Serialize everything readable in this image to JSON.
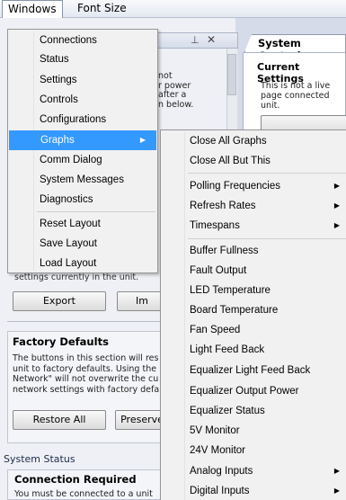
{
  "menubar": {
    "windows": "Windows",
    "font_size": "Font Size"
  },
  "background": {
    "panel_side_text": "not\nr power\nafter a\nn below.",
    "system_controls_tab": "System Controls",
    "current_settings_title": "Current Settings",
    "current_settings_note": "This is not a live page connected unit.",
    "settings_text": "settings currently in the unit.",
    "export_button": "Export",
    "import_button": "Im",
    "factory_defaults_title": "Factory Defaults",
    "factory_defaults_text": "The buttons in this section will res unit to factory defaults. Using the Network\" will not overwrite the cu network settings with factory defa",
    "restore_all_button": "Restore All",
    "preserve_button": "Preserve",
    "system_status_label": "System Status",
    "connection_required_title": "Connection Required",
    "connection_required_text": "You must be connected to a unit"
  },
  "windows_menu": {
    "items": [
      {
        "label": "Connections"
      },
      {
        "label": "Status"
      },
      {
        "label": "Settings"
      },
      {
        "label": "Controls"
      },
      {
        "label": "Configurations"
      },
      {
        "label": "Graphs"
      },
      {
        "label": "Comm Dialog"
      },
      {
        "label": "System Messages"
      },
      {
        "label": "Diagnostics"
      },
      {
        "label": "Reset Layout"
      },
      {
        "label": "Save Layout"
      },
      {
        "label": "Load Layout"
      }
    ]
  },
  "graphs_submenu": {
    "items": [
      {
        "label": "Close All Graphs"
      },
      {
        "label": "Close All But This"
      },
      {
        "label": "Polling Frequencies"
      },
      {
        "label": "Refresh Rates"
      },
      {
        "label": "Timespans"
      },
      {
        "label": "Buffer Fullness"
      },
      {
        "label": "Fault Output"
      },
      {
        "label": "LED Temperature"
      },
      {
        "label": "Board Temperature"
      },
      {
        "label": "Fan Speed"
      },
      {
        "label": "Light Feed Back"
      },
      {
        "label": "Equalizer Light Feed Back"
      },
      {
        "label": "Equalizer Output Power"
      },
      {
        "label": "Equalizer Status"
      },
      {
        "label": "5V Monitor"
      },
      {
        "label": "24V Monitor"
      },
      {
        "label": "Analog Inputs"
      },
      {
        "label": "Digital Inputs"
      }
    ]
  },
  "colors": {
    "highlight": "#3399ff"
  }
}
